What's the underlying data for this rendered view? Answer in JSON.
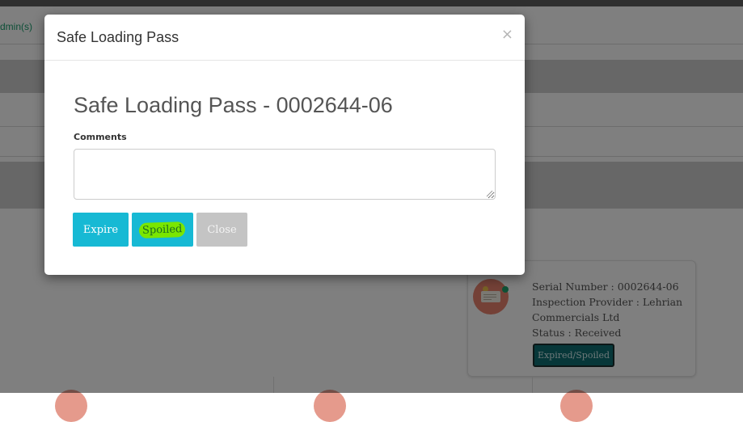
{
  "background": {
    "admin_link": "dmin(s)",
    "card": {
      "lines": [
        "Serial Number : 0002644-06",
        "Inspection Provider : Lehrian",
        "Commercials Ltd",
        "Status : Received"
      ],
      "button_label": "Expired/Spoiled",
      "icon": "document-card-icon"
    }
  },
  "modal": {
    "title": "Safe Loading Pass",
    "close_glyph": "×",
    "heading": "Safe Loading Pass - 0002644-06",
    "comments_label": "Comments",
    "comments_value": "",
    "buttons": {
      "expire": "Expire",
      "spoiled": "Spoiled",
      "close": "Close"
    }
  },
  "colors": {
    "accent": "#17b9d4",
    "highlight": "#7ae600",
    "close_button": "#c4c4c4",
    "card_button": "#0f6e72"
  }
}
